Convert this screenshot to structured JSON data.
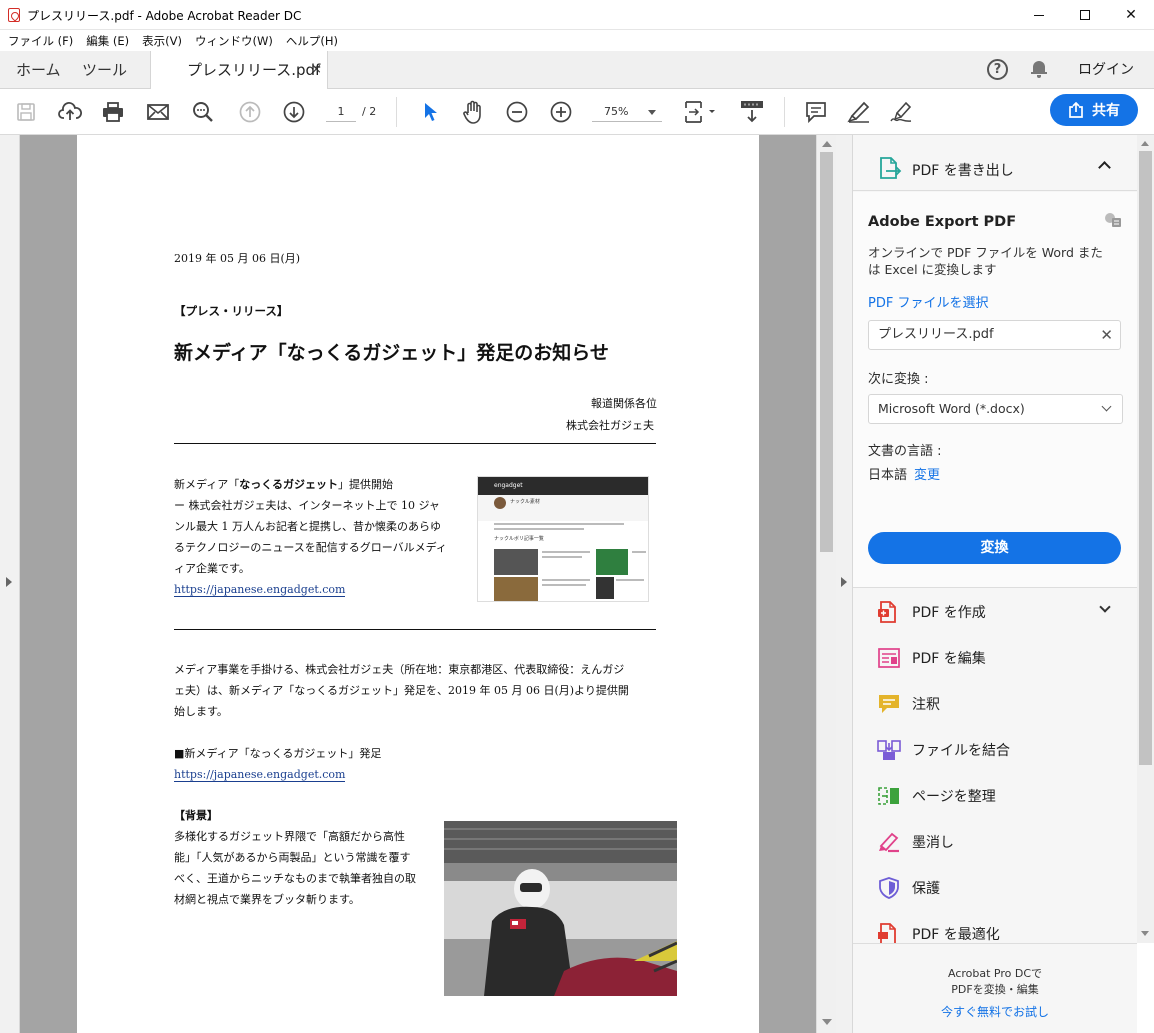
{
  "window": {
    "title": "プレスリリース.pdf - Adobe Acrobat Reader DC"
  },
  "menu": [
    "ファイル (F)",
    "編集 (E)",
    "表示(V)",
    "ウィンドウ(W)",
    "ヘルプ(H)"
  ],
  "tabs": {
    "home": "ホーム",
    "tools": "ツール",
    "document": "プレスリリース.pdf",
    "close": "×",
    "help": "?",
    "login": "ログイン"
  },
  "toolbar": {
    "page_current": "1",
    "page_total": "/ 2",
    "zoom": "75%",
    "share": "共有",
    "icons": [
      "save-icon",
      "upload-cloud-icon",
      "print-icon",
      "mail-icon",
      "search-zoom-icon",
      "page-up-icon",
      "page-down-icon",
      "select-cursor-icon",
      "hand-icon",
      "zoom-out-icon",
      "zoom-in-icon",
      "fit-page-icon",
      "scroll-mode-icon",
      "comment-icon",
      "highlight-pen-icon",
      "sign-icon"
    ]
  },
  "document": {
    "date": "2019 年 05 月 06 日(月)",
    "kicker": "【プレス・リリース】",
    "headline": "新メディア「なっくるガジェット」発足のお知らせ",
    "recipient1": "報道関係各位",
    "recipient2": "株式会社ガジェ夫",
    "section1": {
      "title_pre": "新メディア「",
      "title_bold": "なっくるガジェット",
      "title_post": "」提供開始",
      "lines": [
        "ー 株式会社ガジェ夫は、インターネット上で 10 ジャ",
        "ンル最大 1 万人んお記者と提携し、昔か懐柔のあらゆ",
        "るテクノロジーのニュースを配信するグローバルメディ",
        "ィア企業です。"
      ],
      "link": "https://japanese.engadget.com"
    },
    "thumb": {
      "site": "engadget",
      "heading": "ナックル素材",
      "section": "ナックルボリ記事一覧"
    },
    "body_lines": [
      "メディア事業を手掛ける、株式会社ガジェ夫（所在地：東京都港区、代表取締役：えんガジ",
      "ェ夫）は、新メディア「なっくるガジェット」発足を、2019 年 05 月 06 日(月)より提供開",
      "始します。"
    ],
    "launch_title": "■新メディア「なっくるガジェット」発足",
    "launch_link": "https://japanese.engadget.com",
    "background_title": "【背景】",
    "background_lines": [
      "多様化するガジェット界隈で「高額だから高性",
      "能」「人気があるから両製品」という常識を覆す",
      "べく、王道からニッチなものまで執筆者独自の取",
      "材網と視点で業界をブッタ斬ります。"
    ]
  },
  "export_panel": {
    "header": "PDF を書き出し",
    "title": "Adobe Export PDF",
    "description": "オンラインで PDF ファイルを Word または Excel に変換します",
    "select_file": "PDF ファイルを選択",
    "file_name": "プレスリリース.pdf",
    "convert_to_label": "次に変換 :",
    "format": "Microsoft Word (*.docx)",
    "language_label": "文書の言語 :",
    "language": "日本語",
    "change": "変更",
    "convert_button": "変換"
  },
  "tools_list": [
    {
      "label": "PDF を作成",
      "icon": "create-pdf-icon"
    },
    {
      "label": "PDF を編集",
      "icon": "edit-pdf-icon"
    },
    {
      "label": "注釈",
      "icon": "comment-icon"
    },
    {
      "label": "ファイルを結合",
      "icon": "combine-files-icon"
    },
    {
      "label": "ページを整理",
      "icon": "organize-pages-icon"
    },
    {
      "label": "墨消し",
      "icon": "redact-icon"
    },
    {
      "label": "保護",
      "icon": "protect-shield-icon"
    },
    {
      "label": "PDF を最適化",
      "icon": "optimize-pdf-icon"
    }
  ],
  "promo": {
    "line1": "Acrobat Pro DCで",
    "line2": "PDFを変換・編集",
    "link": "今すぐ無料でお試し"
  },
  "colors": {
    "accent_blue": "#1473e6",
    "pdf_red": "#e03c31",
    "edit_pink": "#e0428a",
    "comment_yellow": "#e4b42b",
    "combine_purple": "#7b5cd6",
    "organize_green": "#3ca23c",
    "protect_purple": "#6e5ed6",
    "export_teal": "#26a69a"
  }
}
